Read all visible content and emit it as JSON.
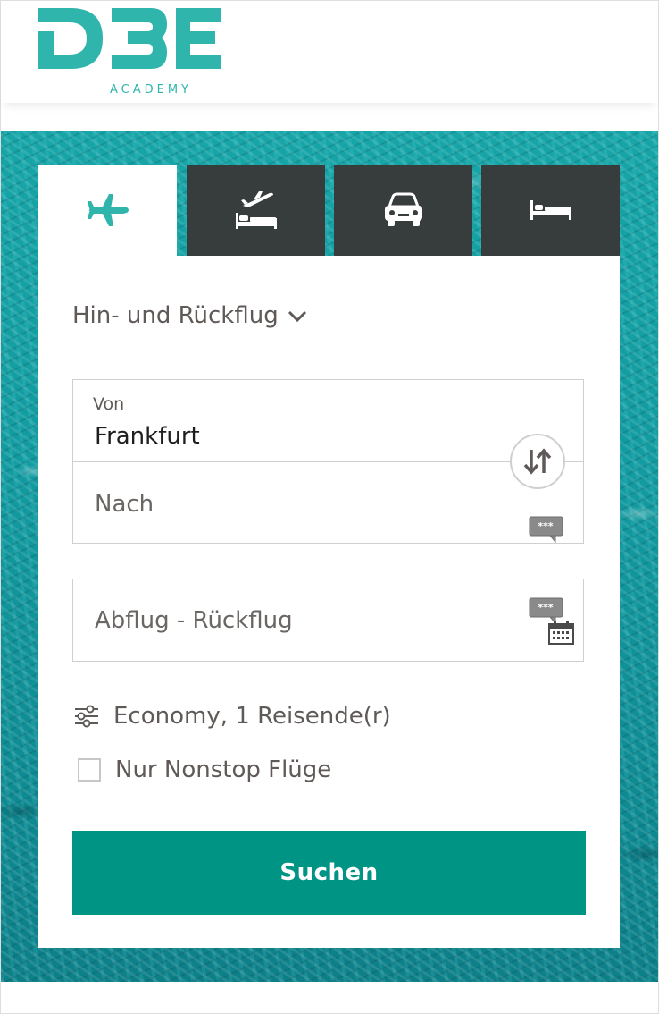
{
  "header": {
    "logo_text": "DBE",
    "logo_subtitle": "ACADEMY"
  },
  "colors": {
    "brand_teal": "#2fb5ac",
    "tab_dark": "#373c3d",
    "button_green": "#009485",
    "text_gray": "#5f5a57"
  },
  "tabs": [
    {
      "name": "flight",
      "icon": "airplane-icon",
      "active": true
    },
    {
      "name": "flight-hotel",
      "icon": "plane-departure-bed-icon",
      "active": false
    },
    {
      "name": "car",
      "icon": "car-icon",
      "active": false
    },
    {
      "name": "hotel",
      "icon": "bed-icon",
      "active": false
    }
  ],
  "form": {
    "trip_type": "Hin- und Rückflug",
    "from": {
      "label": "Von",
      "value": "Frankfurt"
    },
    "to": {
      "placeholder": "Nach"
    },
    "swap_icon": "swap-arrows-icon",
    "dates": {
      "placeholder": "Abflug - Rückflug"
    },
    "passengers": "Economy, 1 Reisende(r)",
    "nonstop": {
      "label": "Nur Nonstop Flüge",
      "checked": false
    },
    "search_button": "Suchen"
  }
}
